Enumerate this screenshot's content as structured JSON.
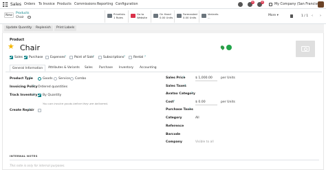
{
  "navbar": {
    "app_name": "Sales",
    "menu": [
      "Orders",
      "To Invoice",
      "Products",
      "Commissions",
      "Reporting",
      "Configuration"
    ],
    "messages_badge": "6",
    "activities_badge": "8",
    "company": "My Company (San Francisco)"
  },
  "control": {
    "new_label": "New",
    "breadcrumb_parent": "Products",
    "breadcrumb_current": "Chair",
    "smart_buttons": [
      {
        "line1": "Pricelists",
        "line2": "1 Rules"
      },
      {
        "line1": "Go to",
        "line2": "Website"
      },
      {
        "line1": "On Hand",
        "line2": "0.00 Units"
      },
      {
        "line1": "Forecasted",
        "line2": "0.00 Units"
      },
      {
        "line1": "Variants",
        "line2": "..."
      }
    ],
    "more_label": "More",
    "pager": "1 / 1"
  },
  "actions": [
    "Update Quantity",
    "Replenish",
    "Print Labels"
  ],
  "product": {
    "label": "Product",
    "name": "Chair",
    "flags": [
      {
        "label": "Sales",
        "checked": true
      },
      {
        "label": "Purchase",
        "checked": true
      },
      {
        "label": "Expenses",
        "checked": false
      },
      {
        "label": "Point of Sale",
        "checked": false
      },
      {
        "label": "Subscriptions",
        "checked": false
      },
      {
        "label": "Rental",
        "checked": false
      }
    ]
  },
  "tabs": [
    "General Information",
    "Attributes & Variants",
    "Sales",
    "Purchase",
    "Inventory",
    "Accounting"
  ],
  "left_fields": {
    "product_type_label": "Product Type",
    "product_type_options": [
      "Goods",
      "Service",
      "Combo"
    ],
    "invoicing_policy_label": "Invoicing Policy",
    "invoicing_policy_value": "Ordered quantities",
    "track_inventory_label": "Track Inventory",
    "track_inventory_value": "By Quantity",
    "track_help": "You can invoice goods before they are delivered.",
    "create_repair_label": "Create Repair"
  },
  "right_fields": {
    "sales_price_label": "Sales Price",
    "sales_price_value": "$ 1,000.00",
    "sales_price_unit": "per Units",
    "sales_taxes_label": "Sales Taxes",
    "avatax_label": "Avatax Category",
    "cost_label": "Cost",
    "cost_value": "$ 0.00",
    "cost_unit": "per Units",
    "purchase_taxes_label": "Purchase Taxes",
    "category_label": "Category",
    "category_value": "All",
    "reference_label": "Reference",
    "barcode_label": "Barcode",
    "company_label": "Company",
    "company_placeholder": "Visible to all"
  },
  "notes": {
    "title": "INTERNAL NOTES",
    "placeholder": "This note is only for internal purposes."
  },
  "colors": {
    "accent": "#017e84",
    "star": "#f3b600",
    "badge": "#d9314a"
  }
}
